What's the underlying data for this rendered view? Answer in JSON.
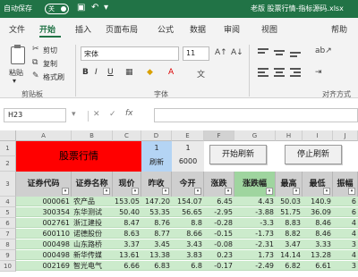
{
  "titlebar": {
    "autosave": "自动保存",
    "toggle": "关",
    "doc": "老版 股票行情-指标源码.xlsx"
  },
  "tabs": [
    "文件",
    "开始",
    "插入",
    "页面布局",
    "公式",
    "数据",
    "审阅",
    "视图",
    "帮助"
  ],
  "ribbon": {
    "paste": "粘贴",
    "cut": "剪切",
    "copy": "复制",
    "format_painter": "格式刷",
    "font_name": "宋体",
    "font_size": "11",
    "bold": "B",
    "italic": "I",
    "underline": "U",
    "group_clipboard": "剪贴板",
    "group_font": "字体",
    "group_align": "对齐方式"
  },
  "formula_bar": {
    "name_box": "H23",
    "formula": ""
  },
  "columns": [
    "A",
    "B",
    "C",
    "D",
    "E",
    "F",
    "G",
    "H",
    "I",
    "J"
  ],
  "rows": [
    "1",
    "2",
    "3",
    "4",
    "5",
    "6",
    "7",
    "8",
    "9",
    "10"
  ],
  "banner": "股票行情",
  "blue_cell": {
    "top": "1",
    "bottom": "刷新"
  },
  "gray_cell": {
    "top": "1",
    "bottom": "6000"
  },
  "buttons": {
    "start": "开始刷新",
    "stop": "停止刷新"
  },
  "table": {
    "headers": [
      "证券代码",
      "证券名称",
      "现价",
      "昨收",
      "今开",
      "涨跌",
      "涨跌幅",
      "最高",
      "最低",
      "振幅"
    ],
    "rows": [
      [
        "000061",
        "农产品",
        "153.05",
        "147.20",
        "154.07",
        "6.45",
        "4.43",
        "50.03",
        "140.9",
        "6"
      ],
      [
        "300354",
        "东华测试",
        "50.40",
        "53.35",
        "56.65",
        "-2.95",
        "-3.88",
        "51.75",
        "36.09",
        "6"
      ],
      [
        "002761",
        "浙江建投",
        "8.47",
        "8.76",
        "8.8",
        "-0.28",
        "-3.3",
        "8.83",
        "8.46",
        "4"
      ],
      [
        "600110",
        "诺德股份",
        "8.63",
        "8.77",
        "8.66",
        "-0.15",
        "-1.73",
        "8.82",
        "8.46",
        "4"
      ],
      [
        "000498",
        "山东路桥",
        "3.37",
        "3.45",
        "3.43",
        "-0.08",
        "-2.31",
        "3.47",
        "3.33",
        "3"
      ],
      [
        "000498",
        "新华传媒",
        "13.61",
        "13.38",
        "3.83",
        "0.23",
        "1.73",
        "14.14",
        "13.28",
        "4"
      ],
      [
        "002169",
        "智光电气",
        "6.66",
        "6.83",
        "6.8",
        "-0.17",
        "-2.49",
        "6.82",
        "6.61",
        "3"
      ]
    ]
  }
}
